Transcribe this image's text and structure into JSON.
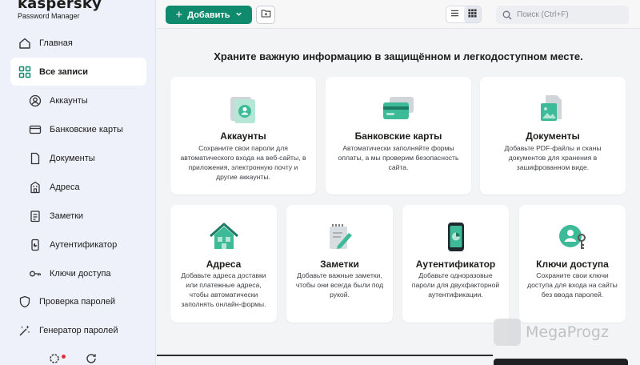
{
  "brand": {
    "name": "kaspersky",
    "subtitle": "Password Manager"
  },
  "sidebar": {
    "items": [
      {
        "label": "Главная",
        "icon": "home-icon"
      },
      {
        "label": "Все записи",
        "icon": "grid-icon",
        "active": true
      },
      {
        "label": "Аккаунты",
        "icon": "account-icon"
      },
      {
        "label": "Банковские карты",
        "icon": "card-icon"
      },
      {
        "label": "Документы",
        "icon": "document-icon"
      },
      {
        "label": "Адреса",
        "icon": "building-icon"
      },
      {
        "label": "Заметки",
        "icon": "note-icon"
      },
      {
        "label": "Аутентификатор",
        "icon": "authenticator-icon"
      },
      {
        "label": "Ключи доступа",
        "icon": "key-icon"
      },
      {
        "label": "Проверка паролей",
        "icon": "shield-icon"
      },
      {
        "label": "Генератор паролей",
        "icon": "generator-icon"
      }
    ]
  },
  "toolbar": {
    "add_label": "Добавить",
    "search_placeholder": "Поиск (Ctrl+F)"
  },
  "main": {
    "headline": "Храните важную информацию в защищённом и легкодоступном месте.",
    "cards_row1": [
      {
        "title": "Аккаунты",
        "desc": "Сохраните свои пароли для автоматического входа на веб-сайты, в приложения, электронную почту и другие аккаунты."
      },
      {
        "title": "Банковские карты",
        "desc": "Автоматически заполняйте формы оплаты, а мы проверим безопасность сайта."
      },
      {
        "title": "Документы",
        "desc": "Добавьте PDF-файлы и сканы документов для хранения в зашифрованном виде."
      }
    ],
    "cards_row2": [
      {
        "title": "Адреса",
        "desc": "Добавьте адреса доставки или платежные адреса, чтобы автоматически заполнять онлайн-формы."
      },
      {
        "title": "Заметки",
        "desc": "Добавьте важные заметки, чтобы они всегда были под рукой."
      },
      {
        "title": "Аутентификатор",
        "desc": "Добавьте одноразовые пароли для двухфакторной аутентификации."
      },
      {
        "title": "Ключи доступа",
        "desc": "Сохраните свои ключи доступа для входа на сайты без ввода паролей."
      }
    ]
  },
  "watermark": {
    "text": "MegaProgz"
  },
  "colors": {
    "accent": "#0f8a6d",
    "sidebar_bg": "#eef0fa",
    "icon_teal": "#3dbb98"
  }
}
